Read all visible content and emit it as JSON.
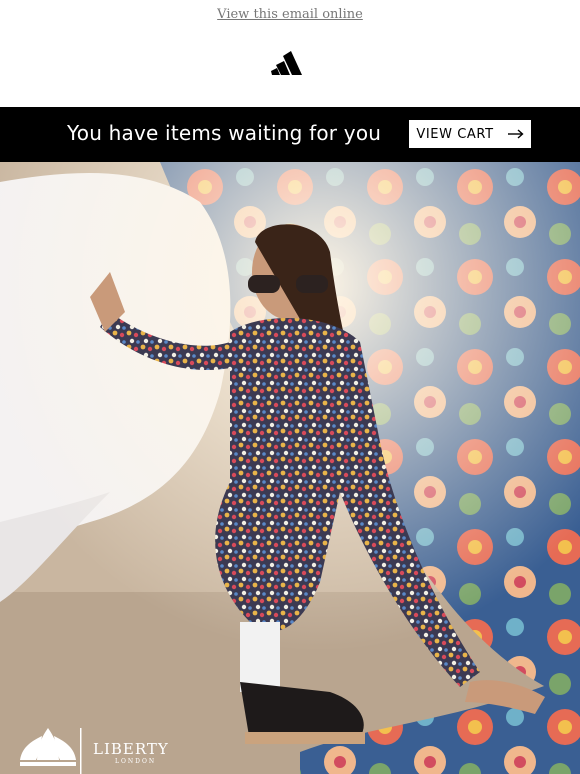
{
  "header": {
    "view_online_label": "View this email online",
    "brand_logo": "adidas-performance-logo"
  },
  "banner": {
    "headline": "You have items waiting for you",
    "cta_label": "VIEW CART",
    "cta_icon": "arrow-right-icon"
  },
  "hero": {
    "collab_logo_left": "adidas-trefoil-logo",
    "collab_logo_right": "LIBERTY",
    "collab_logo_right_sub": "LONDON"
  },
  "colors": {
    "banner_bg": "#000000",
    "banner_text": "#ffffff",
    "link": "#777777"
  }
}
